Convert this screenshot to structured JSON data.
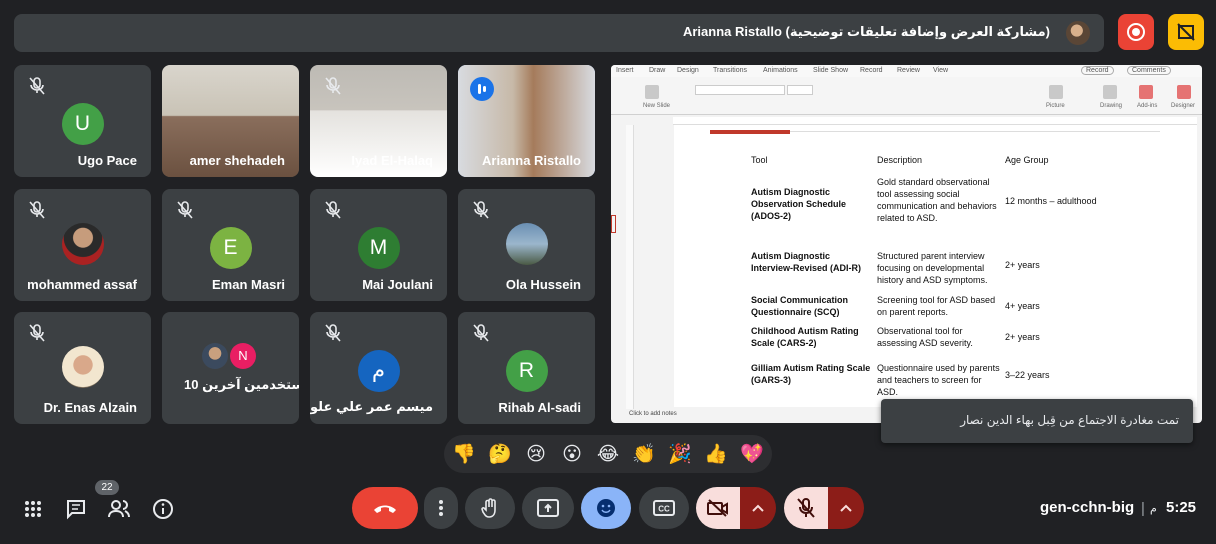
{
  "banner": {
    "presenter_title": "Arianna Ristallo (مشاركة العرض وإضافة تعليقات توضيحية)"
  },
  "top_controls": {
    "record_icon": "record-icon",
    "highlight_icon": "no-highlight-icon"
  },
  "participants": [
    {
      "name": "Ugo Pace",
      "type": "letter",
      "letter": "U",
      "color": "#43a047",
      "muted": true
    },
    {
      "name": "amer shehadeh",
      "type": "video",
      "muted": false
    },
    {
      "name": "Iyad El-Halaq",
      "type": "video",
      "muted": true
    },
    {
      "name": "Arianna Ristallo",
      "type": "video",
      "muted": false,
      "speaking": true
    },
    {
      "name": "mohammed assaf",
      "type": "photo",
      "muted": true
    },
    {
      "name": "Eman Masri",
      "type": "letter",
      "letter": "E",
      "color": "#7cb342",
      "muted": true
    },
    {
      "name": "Mai Joulani",
      "type": "letter",
      "letter": "M",
      "color": "#2e7d32",
      "muted": true
    },
    {
      "name": "Ola Hussein",
      "type": "photo",
      "muted": true
    },
    {
      "name": "Dr. Enas Alzain",
      "type": "photo",
      "muted": true
    },
    {
      "name": "10 مستخدمين آخرين",
      "type": "group",
      "letter": "N",
      "color": "#e91e63",
      "muted": false
    },
    {
      "name": "ميسم عمر علي علوان",
      "type": "letter",
      "letter": "م",
      "color": "#1565c0",
      "muted": true
    },
    {
      "name": "Rihab Al-sadi",
      "type": "letter",
      "letter": "R",
      "color": "#43a047",
      "muted": true
    }
  ],
  "presentation": {
    "menu": [
      "Insert",
      "Draw",
      "Design",
      "Transitions",
      "Animations",
      "Slide Show",
      "Record",
      "Review",
      "View"
    ],
    "record_label": "Record",
    "comments_label": "Comments",
    "ribbon": {
      "new_slide": "New Slide",
      "picture": "Picture",
      "drawing": "Drawing",
      "add_ins": "Add-ins",
      "designer": "Designer"
    },
    "notes_hint": "Click to add notes",
    "table": {
      "headers": [
        "Tool",
        "Description",
        "Age Group"
      ],
      "rows": [
        {
          "tool": "Autism Diagnostic Observation Schedule (ADOS-2)",
          "description": "Gold standard observational tool assessing social communication and behaviors related to ASD.",
          "age": "12 months – adulthood"
        },
        {
          "tool": "Autism Diagnostic Interview-Revised (ADI-R)",
          "description": "Structured parent interview focusing on developmental history and ASD symptoms.",
          "age": "2+ years"
        },
        {
          "tool": "Social Communication Questionnaire (SCQ)",
          "description": "Screening tool for ASD based on parent reports.",
          "age": "4+ years"
        },
        {
          "tool": "Childhood Autism Rating Scale (CARS-2)",
          "description": "Observational tool for assessing ASD severity.",
          "age": "2+ years"
        },
        {
          "tool": "Gilliam Autism Rating Scale (GARS-3)",
          "description": "Questionnaire used by parents and teachers to screen for ASD.",
          "age": "3–22 years"
        }
      ]
    }
  },
  "toast": {
    "message": "تمت مغادرة الاجتماع من قِبل بهاء الدين نصار"
  },
  "reactions": [
    "👎",
    "🤔",
    "😢",
    "😮",
    "😂",
    "👏",
    "🎉",
    "👍",
    "💖"
  ],
  "bottom": {
    "time": "5:25",
    "ampm": "م",
    "separator": "|",
    "meeting_code": "gen-cchn-big",
    "people_count": "22"
  }
}
